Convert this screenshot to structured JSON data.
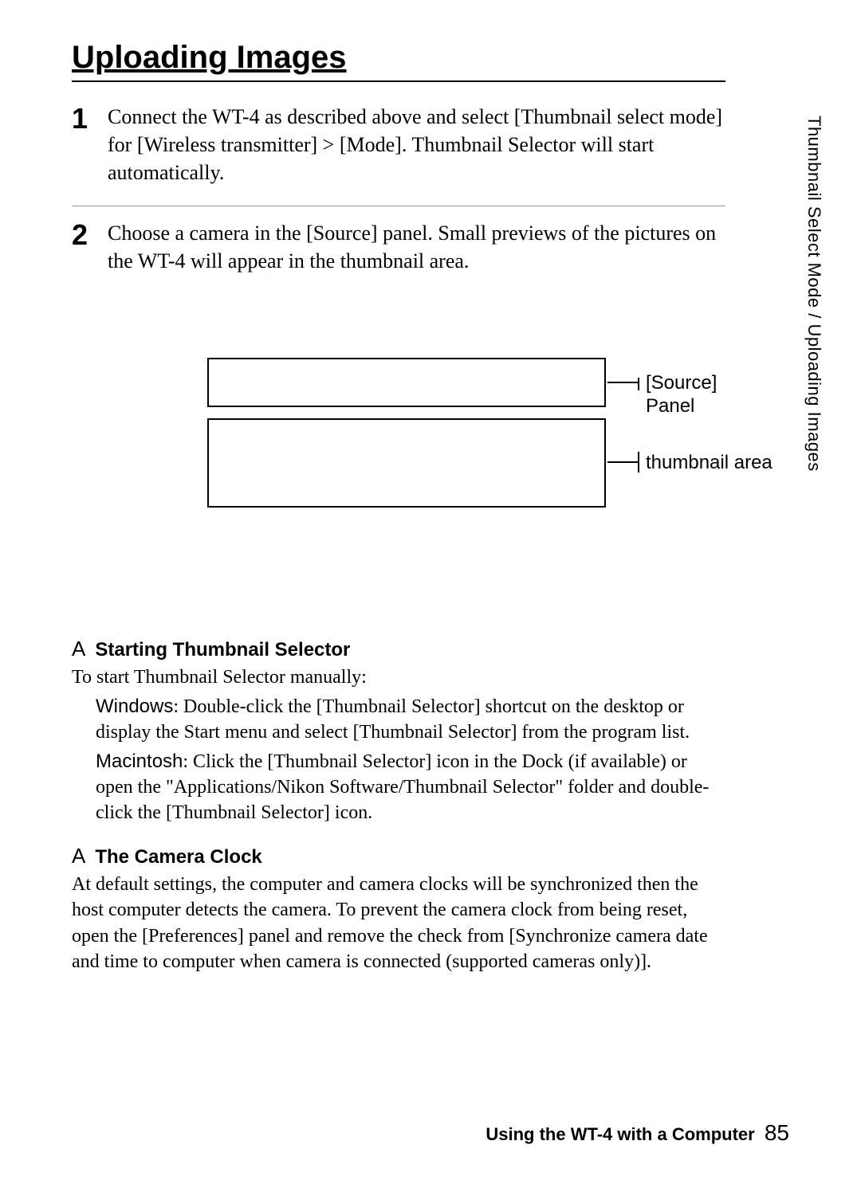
{
  "title": "Uploading Images",
  "side_tab": "Thumbnail Select Mode / Uploading Images",
  "steps": [
    {
      "num": "1",
      "text": "Connect the WT-4 as described above and select [Thumbnail select mode] for [Wireless transmitter] > [Mode]. Thumbnail Selector will start automatically."
    },
    {
      "num": "2",
      "text": "Choose a camera in the [Source] panel. Small previews of the pictures on the WT-4 will appear in the thumbnail area."
    }
  ],
  "diagram": {
    "source_label": "[Source] Panel",
    "thumb_label": "thumbnail area"
  },
  "notes": {
    "a_mark": "A",
    "n1_title": "Starting Thumbnail Selector",
    "n1_intro": "To start Thumbnail Selector manually:",
    "n1_win_label": "Windows",
    "n1_win_text": ": Double-click the [Thumbnail Selector] shortcut on the desktop or display the Start menu and select [Thumbnail Selector] from the program list.",
    "n1_mac_label": "Macintosh",
    "n1_mac_text": ": Click the [Thumbnail Selector] icon in the Dock (if available) or open the \"Applications/Nikon Software/Thumbnail Selector\" folder and double-click the [Thumbnail Selector] icon.",
    "n2_title": "The Camera Clock",
    "n2_text": "At default settings, the computer and camera clocks will be synchronized then the host computer detects the camera. To prevent the camera clock from being reset, open the [Preferences] panel and remove the check from [Synchronize camera date and time to computer when camera is connected (supported cameras only)]."
  },
  "footer": {
    "text": "Using the WT-4 with a Computer",
    "page": "85"
  }
}
